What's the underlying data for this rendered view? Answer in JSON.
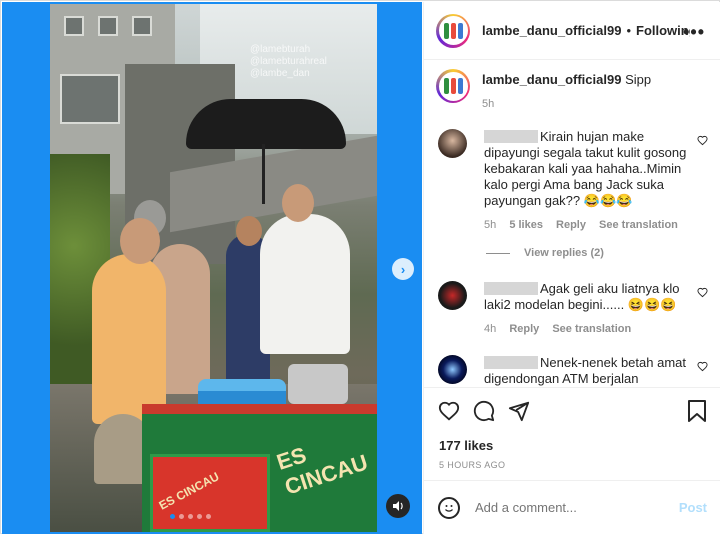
{
  "header": {
    "username": "lambe_danu_official99",
    "separator": "•",
    "follow_label": "Following",
    "more_label": "•••"
  },
  "caption": {
    "username": "lambe_danu_official99",
    "text": "Sipp",
    "time": "5h"
  },
  "comments": [
    {
      "text": "Kirain hujan make dipayungi segala takut kulit gosong kebakaran kali yaa hahaha..Mimin kalo pergi Ama bang Jack suka payungan gak?? 😂😂😂",
      "time": "5h",
      "likes": "5 likes",
      "reply": "Reply",
      "translate": "See translation",
      "view_replies": "View replies (2)"
    },
    {
      "text": "Agak geli aku liatnya klo laki2 modelan begini...... 😆😆😆",
      "time": "4h",
      "reply": "Reply",
      "translate": "See translation"
    },
    {
      "text": "Nenek-nenek betah amat digendongan ATM berjalan"
    }
  ],
  "post": {
    "likes": "177 likes",
    "posted": "5 HOURS AGO"
  },
  "add_comment": {
    "placeholder": "Add a comment...",
    "post_label": "Post"
  },
  "media": {
    "cart_text": "ES CINCAU",
    "cart_text2": "ES CINCAU",
    "watermark": "@lamebturah\n@lamebturahreal\n@lambe_dan",
    "slide_count": 5,
    "active_slide": 1
  },
  "colors": {
    "media_bg": "#1a8df2",
    "post_disabled": "#b2dffc",
    "meta_gray": "#8e8e8e"
  }
}
